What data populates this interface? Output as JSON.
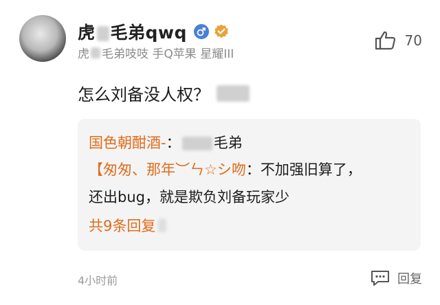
{
  "comment": {
    "username_left": "虎",
    "username_right": "毛弟qwq",
    "meta_left": "虎",
    "meta_right": "毛弟吱吱 手Q苹果 星耀III",
    "text": "怎么刘备没人权？",
    "like_count": "70",
    "time": "4小时前",
    "reply_label": "回复"
  },
  "replies": {
    "first_author": "国色朝酣酒-",
    "first_sep": "：",
    "first_target": "毛弟",
    "second_author": "【匆匆、那年︶ㄣ☆シ吻",
    "second_sep": "：",
    "second_text_line1": "不加强旧算了，",
    "second_text_line2": "还出bug，就是欺负刘备玩家少",
    "more": "共9条回复"
  },
  "colors": {
    "accent": "#e06c1c",
    "reply_bg": "#f4f4f4",
    "gender_blue": "#4a7fd6",
    "vip_gold": "#e8a33a"
  },
  "icons": {
    "gender": "male-gender-icon",
    "vip": "verified-badge-icon",
    "like": "thumbs-up-icon",
    "reply": "comment-bubble-icon"
  }
}
